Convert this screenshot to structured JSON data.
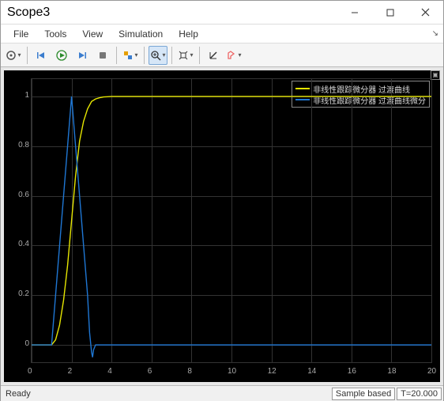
{
  "window": {
    "title": "Scope3"
  },
  "menu": {
    "file": "File",
    "tools": "Tools",
    "view": "View",
    "simulation": "Simulation",
    "help": "Help"
  },
  "status": {
    "ready": "Ready",
    "sample": "Sample based",
    "time": "T=20.000"
  },
  "legend": {
    "s1": "非线性跟踪微分器 过渡曲线",
    "s2": "非线性跟踪微分器 过渡曲线微分"
  },
  "xticks": [
    "0",
    "2",
    "4",
    "6",
    "8",
    "10",
    "12",
    "14",
    "16",
    "18",
    "20"
  ],
  "yticks": [
    "0",
    "0.2",
    "0.4",
    "0.6",
    "0.8",
    "1"
  ],
  "chart_data": {
    "type": "line",
    "xlim": [
      0,
      20
    ],
    "ylim": [
      -0.07,
      1.07
    ],
    "series": [
      {
        "name": "非线性跟踪微分器 过渡曲线",
        "color": "#e6e600",
        "x": [
          0,
          1.0,
          1.2,
          1.4,
          1.6,
          1.8,
          2.0,
          2.2,
          2.4,
          2.6,
          2.8,
          3.0,
          3.2,
          3.4,
          3.6,
          3.8,
          4.0,
          4.5,
          5.0,
          6.0,
          8.0,
          12.0,
          20.0
        ],
        "y": [
          0,
          0.0,
          0.02,
          0.08,
          0.18,
          0.32,
          0.5,
          0.68,
          0.82,
          0.9,
          0.95,
          0.98,
          0.99,
          0.995,
          0.998,
          0.999,
          1.0,
          1.0,
          1.0,
          1.0,
          1.0,
          1.0,
          1.0
        ]
      },
      {
        "name": "非线性跟踪微分器 过渡曲线微分",
        "color": "#1f77d4",
        "x": [
          0,
          1.0,
          1.2,
          1.4,
          1.6,
          1.8,
          2.0,
          2.2,
          2.4,
          2.6,
          2.8,
          2.9,
          3.0,
          3.05,
          3.1,
          3.2,
          3.5,
          4.0,
          6.0,
          10.0,
          20.0
        ],
        "y": [
          0,
          0.0,
          0.2,
          0.4,
          0.6,
          0.8,
          1.0,
          0.8,
          0.6,
          0.4,
          0.2,
          0.05,
          -0.03,
          -0.05,
          -0.02,
          0.0,
          0.0,
          0.0,
          0.0,
          0.0,
          0.0
        ]
      }
    ]
  }
}
